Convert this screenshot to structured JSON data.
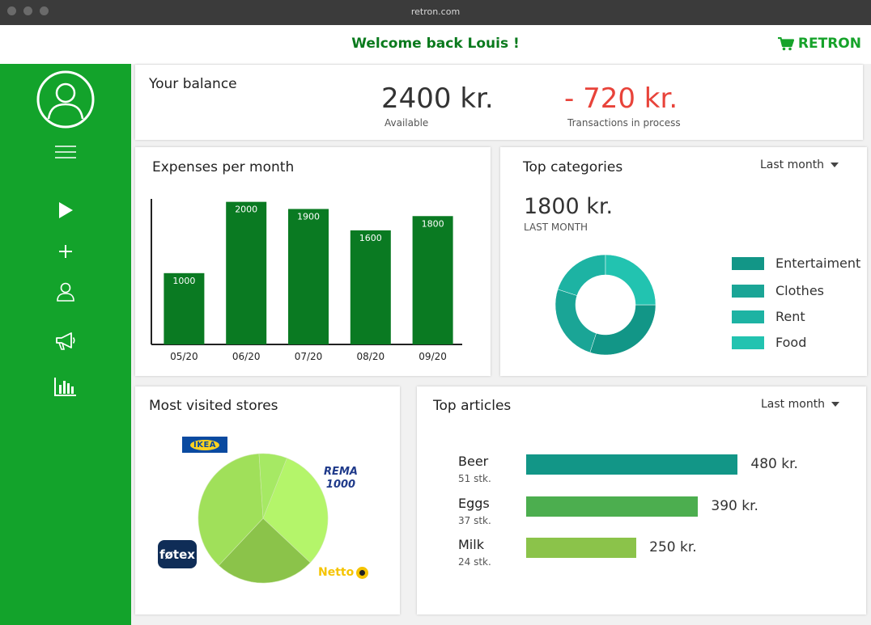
{
  "browser": {
    "url": "retron.com"
  },
  "header": {
    "welcome": "Welcome back Louis !",
    "brand": "RETRON"
  },
  "sidebar": {
    "icons": [
      "avatar-icon",
      "menu-icon",
      "play-icon",
      "add-icon",
      "user-icon",
      "megaphone-icon",
      "bar-chart-icon"
    ]
  },
  "balance": {
    "title": "Your balance",
    "available_amount": "2400 kr.",
    "available_label": "Available",
    "pending_amount": "- 720 kr.",
    "pending_label": "Transactions in process"
  },
  "expenses": {
    "title": "Expenses per month"
  },
  "categories": {
    "title": "Top categories",
    "filter": "Last month",
    "amount": "1800 kr.",
    "amount_label": "LAST MONTH",
    "legend": [
      {
        "label": "Entertaiment",
        "color": "#129687"
      },
      {
        "label": "Clothes",
        "color": "#1aa596"
      },
      {
        "label": "Rent",
        "color": "#1db3a3"
      },
      {
        "label": "Food",
        "color": "#22c3b0"
      }
    ]
  },
  "stores": {
    "title": "Most visited stores",
    "labels": {
      "ikea": "IKEA",
      "rema": "REMA 1000",
      "netto": "Netto",
      "fotex": "føtex"
    }
  },
  "articles": {
    "title": "Top articles",
    "filter": "Last month",
    "items": [
      {
        "name": "Beer",
        "qty": "51 stk.",
        "value": "480 kr.",
        "color": "#129687"
      },
      {
        "name": "Eggs",
        "qty": "37 stk.",
        "value": "390 kr.",
        "color": "#4cae4f"
      },
      {
        "name": "Milk",
        "qty": "24 stk.",
        "value": "250 kr.",
        "color": "#8bc34a"
      }
    ]
  },
  "chart_data": [
    {
      "type": "bar",
      "categories": [
        "05/20",
        "06/20",
        "07/20",
        "08/20",
        "09/20"
      ],
      "values": [
        1000,
        2000,
        1900,
        1600,
        1800
      ],
      "title": "Expenses per month",
      "xlabel": "",
      "ylabel": "",
      "ylim": [
        0,
        2200
      ],
      "grid": false,
      "color": "#0a7a22",
      "data_labels": [
        "1000",
        "2000",
        "1900",
        "1600",
        "1800"
      ]
    },
    {
      "type": "pie",
      "title": "Top categories",
      "donut": true,
      "categories": [
        "Entertaiment",
        "Clothes",
        "Rent",
        "Food"
      ],
      "values": [
        30,
        25,
        20,
        25
      ],
      "colors": [
        "#129687",
        "#1aa596",
        "#1db3a3",
        "#22c3b0"
      ],
      "legend": "right"
    },
    {
      "type": "pie",
      "title": "Most visited stores",
      "categories": [
        "REMA 1000",
        "Netto",
        "føtex",
        "IKEA"
      ],
      "values": [
        31,
        25,
        37,
        7
      ],
      "colors": [
        "#b4f56a",
        "#8bc34a",
        "#a0e05a",
        "#a6e964"
      ]
    },
    {
      "type": "bar",
      "title": "Top articles",
      "orientation": "horizontal",
      "categories": [
        "Beer",
        "Eggs",
        "Milk"
      ],
      "values": [
        480,
        390,
        250
      ],
      "xlim": [
        0,
        560
      ]
    }
  ]
}
